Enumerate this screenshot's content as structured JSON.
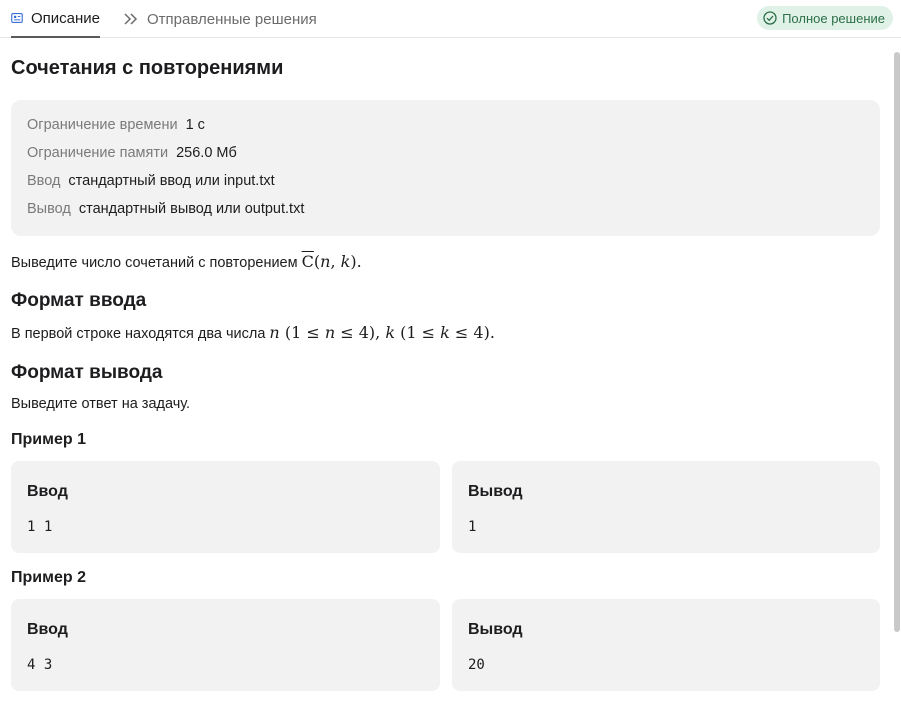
{
  "tabs": {
    "description": "Описание",
    "submissions": "Отправленные решения"
  },
  "status_badge": "Полное решение",
  "problem": {
    "title": "Сочетания с повторениями",
    "limits": [
      {
        "label": "Ограничение времени",
        "value": "1 с"
      },
      {
        "label": "Ограничение памяти",
        "value": "256.0 Мб"
      },
      {
        "label": "Ввод",
        "value": "стандартный ввод или input.txt"
      },
      {
        "label": "Вывод",
        "value": "стандартный вывод или output.txt"
      }
    ],
    "statement_text": "Выведите число сочетаний с повторением",
    "statement_math": "C(n, k).",
    "input_heading": "Формат ввода",
    "input_text": "В первой строке находятся два числа",
    "input_math": "n (1 ≤ n ≤ 4), k (1 ≤ k ≤ 4).",
    "output_heading": "Формат вывода",
    "output_text": "Выведите ответ на задачу."
  },
  "examples": [
    {
      "title": "Пример 1",
      "input_label": "Ввод",
      "input": "1 1",
      "output_label": "Вывод",
      "output": "1"
    },
    {
      "title": "Пример 2",
      "input_label": "Ввод",
      "input": "4 3",
      "output_label": "Вывод",
      "output": "20"
    }
  ],
  "colors": {
    "accent_tab_underline": "#5a5a5a",
    "badge_bg": "#e0f2e7",
    "badge_text": "#2c6e48",
    "card_bg": "#f2f2f2"
  }
}
